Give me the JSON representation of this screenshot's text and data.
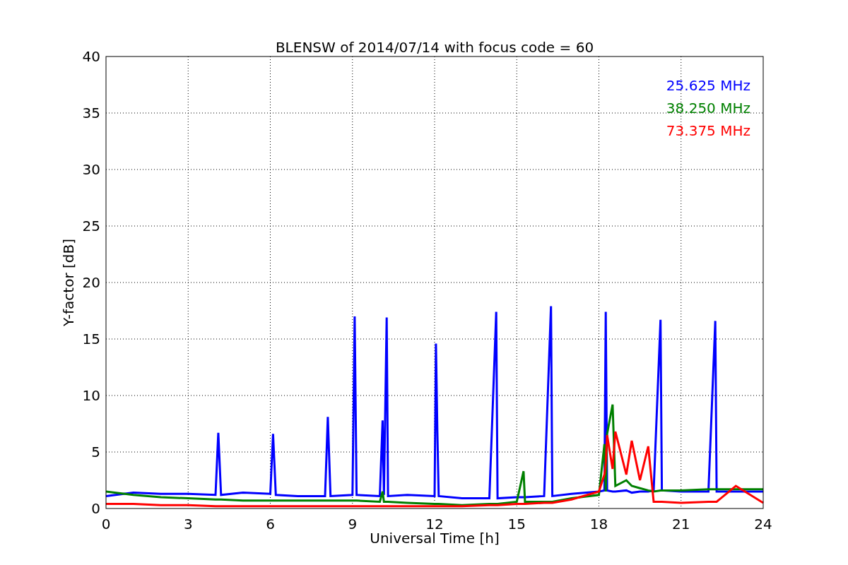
{
  "chart_data": {
    "type": "line",
    "title": "BLENSW of 2014/07/14 with focus code = 60",
    "xlabel": "Universal Time [h]",
    "ylabel": "Y-factor [dB]",
    "x": [
      0,
      1,
      2,
      3,
      4,
      4.1,
      4.2,
      5,
      6,
      6.1,
      6.2,
      7,
      8,
      8.1,
      8.2,
      9,
      9.08,
      9.15,
      10,
      10.1,
      10.15,
      10.25,
      10.3,
      11,
      12,
      12.05,
      12.1,
      12.15,
      13,
      14,
      14.25,
      14.3,
      15,
      15.25,
      15.3,
      16,
      16.25,
      16.3,
      17,
      18,
      18.2,
      18.25,
      18.3,
      18.5,
      18.6,
      19,
      19.2,
      19.5,
      19.8,
      20,
      20.25,
      20.3,
      21,
      22,
      22.25,
      22.3,
      23,
      24
    ],
    "series": [
      {
        "name": "25.625 MHz",
        "color": "#0000ff",
        "values": [
          1.1,
          1.4,
          1.3,
          1.3,
          1.2,
          6.7,
          1.2,
          1.4,
          1.3,
          6.6,
          1.2,
          1.1,
          1.1,
          8.1,
          1.1,
          1.2,
          17,
          1.2,
          1.1,
          7.8,
          1.2,
          16.9,
          1.1,
          1.2,
          1.1,
          14.6,
          6.8,
          1.1,
          0.9,
          0.9,
          17.4,
          0.9,
          1,
          1,
          1,
          1.1,
          17.9,
          1.1,
          1.3,
          1.5,
          1.6,
          17.4,
          1.6,
          1.5,
          1.5,
          1.6,
          1.4,
          1.5,
          1.5,
          1.6,
          16.7,
          1.6,
          1.5,
          1.5,
          16.6,
          1.5,
          1.5,
          1.5
        ]
      },
      {
        "name": "38.250 MHz",
        "color": "#008000",
        "values": [
          1.5,
          1.2,
          1.0,
          0.9,
          0.8,
          0.8,
          0.8,
          0.7,
          0.7,
          0.7,
          0.7,
          0.7,
          0.7,
          0.7,
          0.7,
          0.7,
          0.7,
          0.7,
          0.6,
          1.5,
          0.6,
          0.6,
          0.6,
          0.5,
          0.4,
          0.4,
          0.4,
          0.4,
          0.3,
          0.4,
          0.4,
          0.4,
          0.6,
          3.3,
          0.6,
          0.6,
          0.6,
          0.6,
          0.9,
          1.2,
          5.7,
          1.5,
          6.6,
          9.2,
          2,
          2.5,
          2,
          1.8,
          1.6,
          1.5,
          1.6,
          1.6,
          1.6,
          1.7,
          1.7,
          1.7,
          1.7,
          1.7
        ]
      },
      {
        "name": "73.375 MHz",
        "color": "#ff0000",
        "values": [
          0.4,
          0.4,
          0.3,
          0.3,
          0.2,
          0.2,
          0.2,
          0.2,
          0.2,
          0.2,
          0.2,
          0.2,
          0.2,
          0.2,
          0.2,
          0.2,
          0.2,
          0.2,
          0.2,
          0.2,
          0.2,
          0.2,
          0.2,
          0.2,
          0.2,
          0.2,
          0.2,
          0.2,
          0.2,
          0.3,
          0.3,
          0.3,
          0.4,
          0.4,
          0.4,
          0.5,
          0.5,
          0.5,
          0.8,
          1.5,
          3,
          4,
          6.5,
          3.5,
          6.8,
          3,
          6,
          2.5,
          5.5,
          0.6,
          0.6,
          0.6,
          0.5,
          0.6,
          0.6,
          0.6,
          2,
          0.5
        ]
      }
    ],
    "xlim": [
      0,
      24
    ],
    "ylim": [
      0,
      40
    ],
    "xticks": [
      0,
      3,
      6,
      9,
      12,
      15,
      18,
      21,
      24
    ],
    "yticks": [
      0,
      5,
      10,
      15,
      20,
      25,
      30,
      35,
      40
    ],
    "grid": true
  }
}
